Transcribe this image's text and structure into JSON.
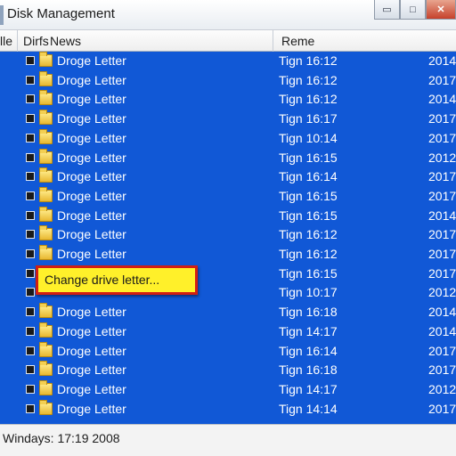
{
  "window": {
    "title": "Disk Management",
    "minimize_glyph": "▭",
    "maximize_glyph": "□",
    "close_glyph": "✕"
  },
  "columns": {
    "c0": "lle",
    "c1": "Dirfs",
    "c2": "News",
    "c3": "Reme"
  },
  "rows": [
    {
      "name": "Droge Letter",
      "time": "Tign 16:12",
      "year": "2014"
    },
    {
      "name": "Droge Letter",
      "time": "Tign 16:12",
      "year": "2017"
    },
    {
      "name": "Droge Letter",
      "time": "Tign 16:12",
      "year": "2014"
    },
    {
      "name": "Droge Letter",
      "time": "Tign 16:17",
      "year": "2017"
    },
    {
      "name": "Droge Letter",
      "time": "Tign 10:14",
      "year": "2017"
    },
    {
      "name": "Droge Letter",
      "time": "Tign 16:15",
      "year": "2012"
    },
    {
      "name": "Droge Letter",
      "time": "Tign 16:14",
      "year": "2017"
    },
    {
      "name": "Droge Letter",
      "time": "Tign 16:15",
      "year": "2017"
    },
    {
      "name": "Droge Letter",
      "time": "Tign 16:15",
      "year": "2014"
    },
    {
      "name": "Droge Letter",
      "time": "Tign 16:12",
      "year": "2017"
    },
    {
      "name": "Droge Letter",
      "time": "Tign 16:12",
      "year": "2017"
    },
    {
      "name": "",
      "time": "Tign 16:15",
      "year": "2017"
    },
    {
      "name": "",
      "time": "Tign 10:17",
      "year": "2012"
    },
    {
      "name": "Droge Letter",
      "time": "Tign 16:18",
      "year": "2014"
    },
    {
      "name": "Droge Letter",
      "time": "Tign 14:17",
      "year": "2014"
    },
    {
      "name": "Droge Letter",
      "time": "Tign 16:14",
      "year": "2017"
    },
    {
      "name": "Droge Letter",
      "time": "Tign 16:18",
      "year": "2017"
    },
    {
      "name": "Droge Letter",
      "time": "Tign 14:17",
      "year": "2012"
    },
    {
      "name": "Droge Letter",
      "time": "Tign 14:14",
      "year": "2017"
    }
  ],
  "context_popup": {
    "label": "Change drive letter..."
  },
  "statusbar": {
    "text": "Windays: 17:19 2008"
  },
  "colors": {
    "list_background": "#1158d6",
    "popup_background": "#fff02a",
    "popup_border": "#d21f12",
    "close_button": "#c6412b"
  },
  "icons": {
    "checkbox": "checkbox-icon",
    "folder": "folder-icon"
  }
}
